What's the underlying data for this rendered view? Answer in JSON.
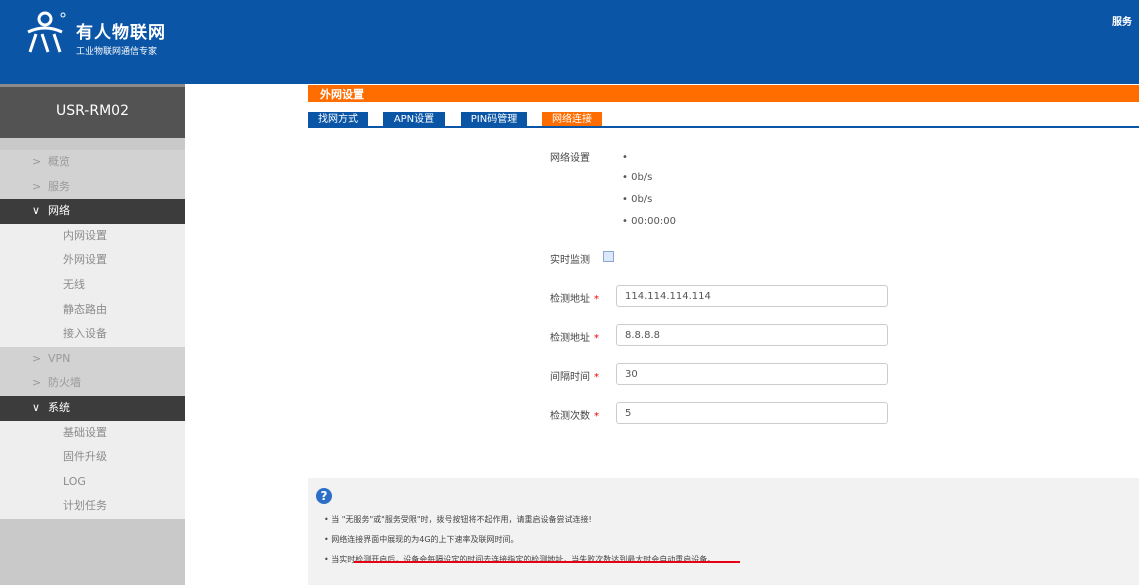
{
  "header": {
    "brand_name": "有人物联网",
    "brand_slogan": "工业物联网通信专家",
    "right_link": "服务"
  },
  "sidebar": {
    "device_name": "USR-RM02",
    "menu": [
      {
        "label": "概览",
        "caret": ">",
        "type": "parent"
      },
      {
        "label": "服务",
        "caret": ">",
        "type": "parent"
      },
      {
        "label": "网络",
        "caret": "∨",
        "type": "open"
      },
      {
        "label": "内网设置",
        "type": "sub"
      },
      {
        "label": "外网设置",
        "type": "sub"
      },
      {
        "label": "无线",
        "type": "sub"
      },
      {
        "label": "静态路由",
        "type": "sub"
      },
      {
        "label": "接入设备",
        "type": "sub"
      },
      {
        "label": "VPN",
        "caret": ">",
        "type": "parent"
      },
      {
        "label": "防火墙",
        "caret": ">",
        "type": "parent"
      },
      {
        "label": "系统",
        "caret": "∨",
        "type": "open"
      },
      {
        "label": "基础设置",
        "type": "sub"
      },
      {
        "label": "固件升级",
        "type": "sub"
      },
      {
        "label": "LOG",
        "type": "sub"
      },
      {
        "label": "计划任务",
        "type": "sub"
      }
    ]
  },
  "main": {
    "section_title": "外网设置",
    "tabs": [
      {
        "label": "找网方式"
      },
      {
        "label": "APN设置"
      },
      {
        "label": "PIN码管理"
      },
      {
        "label": "网络连接",
        "active": true
      }
    ],
    "network_status": {
      "label": "网络设置",
      "items": [
        "",
        "0b/s",
        "0b/s",
        "00:00:00"
      ]
    },
    "realtime_monitor_label": "实时监测",
    "fields": [
      {
        "label": "检测地址",
        "value": "114.114.114.114"
      },
      {
        "label": "检测地址",
        "value": "8.8.8.8"
      },
      {
        "label": "间隔时间",
        "value": "30"
      },
      {
        "label": "检测次数",
        "value": "5"
      }
    ],
    "required_mark": "*"
  },
  "help": {
    "icon": "question-circle-icon",
    "lines": [
      "• 当 \"无服务\"或\"服务受限\"时，拨号按钮将不起作用，请重启设备尝试连接!",
      "• 网络连接界面中展现的为4G的上下速率及联网时间。",
      "• 当实时检测开启后，设备会每隔设定的时间去连接指定的检测地址，当失败次数达到最大时会自动重启设备。"
    ]
  },
  "colors": {
    "header_blue": "#0a55a6",
    "accent_orange": "#ff6c00",
    "sidebar_dark": "#3c3c3c",
    "underline_red": "#e60012"
  }
}
